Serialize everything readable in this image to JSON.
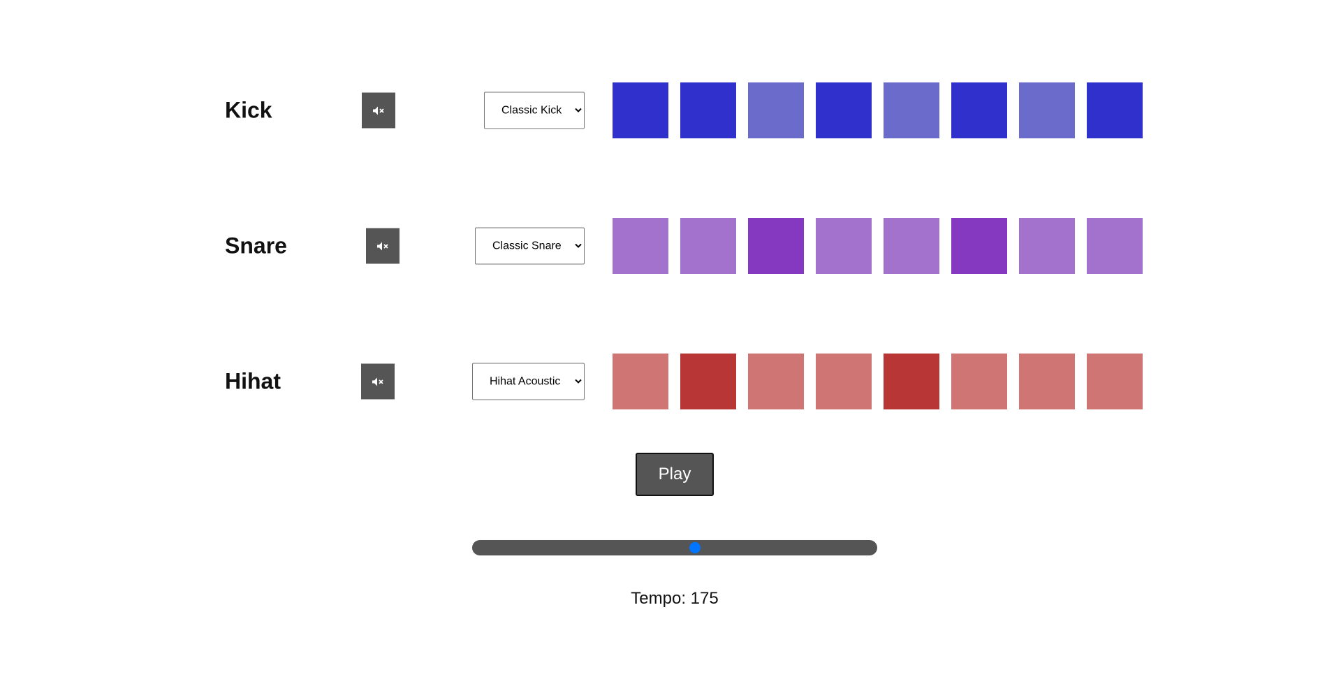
{
  "tracks": [
    {
      "name": "Kick",
      "selected_sound": "Classic Kick",
      "mute_icon": "speaker-mute-icon",
      "steps_active": [
        true,
        true,
        false,
        true,
        false,
        true,
        false,
        true
      ],
      "active_color": "#3030cc",
      "inactive_color": "#6b6bcc"
    },
    {
      "name": "Snare",
      "selected_sound": "Classic Snare",
      "mute_icon": "speaker-mute-icon",
      "steps_active": [
        false,
        false,
        true,
        false,
        false,
        true,
        false,
        false
      ],
      "active_color": "#8439c0",
      "inactive_color": "#a272cc"
    },
    {
      "name": "Hihat",
      "selected_sound": "Hihat Acoustic",
      "mute_icon": "speaker-mute-icon",
      "steps_active": [
        false,
        true,
        false,
        false,
        true,
        false,
        false,
        false
      ],
      "active_color": "#b83636",
      "inactive_color": "#cf7574"
    }
  ],
  "controls": {
    "play_label": "Play",
    "tempo_text": "Tempo: 175",
    "tempo_fraction": 0.55,
    "slider_track_color": "#555555",
    "slider_thumb_color": "#0075ff"
  }
}
